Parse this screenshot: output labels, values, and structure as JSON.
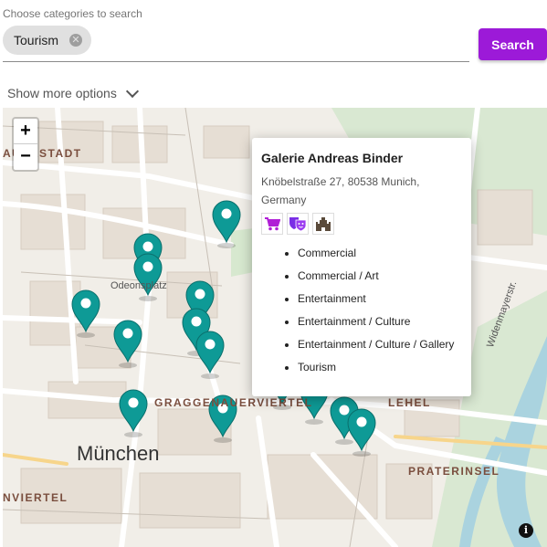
{
  "search": {
    "label": "Choose categories to search",
    "selected_chips": [
      {
        "label": "Tourism",
        "remove_icon": "close-circle-icon"
      }
    ],
    "search_button_label": "Search",
    "accent_color": "#9c1ad8"
  },
  "options": {
    "toggle_label": "Show more options",
    "toggle_icon": "chevron-down-icon"
  },
  "map": {
    "zoom_in_label": "+",
    "zoom_out_label": "−",
    "attribution_icon": "info-icon",
    "labels": {
      "district_top_left": "AUERSTADT",
      "district_center": "GRAGGENAUERVIERTEL",
      "district_right": "LEHEL",
      "district_bottom_right": "PRATERINSEL",
      "district_bottom_left": "NVIERTEL",
      "city": "München",
      "place": "Odeonsplatz",
      "street": "Widenmayerstr."
    },
    "marker_color": "#0e9a96",
    "marker_count": 15,
    "popup": {
      "title": "Galerie Andreas Binder",
      "address": "Knöbelstraße 27, 80538 Munich, Germany",
      "icons": [
        "shopping-cart-icon",
        "theater-masks-icon",
        "castle-icon"
      ],
      "categories": [
        "Commercial",
        "Commercial / Art",
        "Entertainment",
        "Entertainment / Culture",
        "Entertainment / Culture / Gallery",
        "Tourism"
      ]
    }
  }
}
